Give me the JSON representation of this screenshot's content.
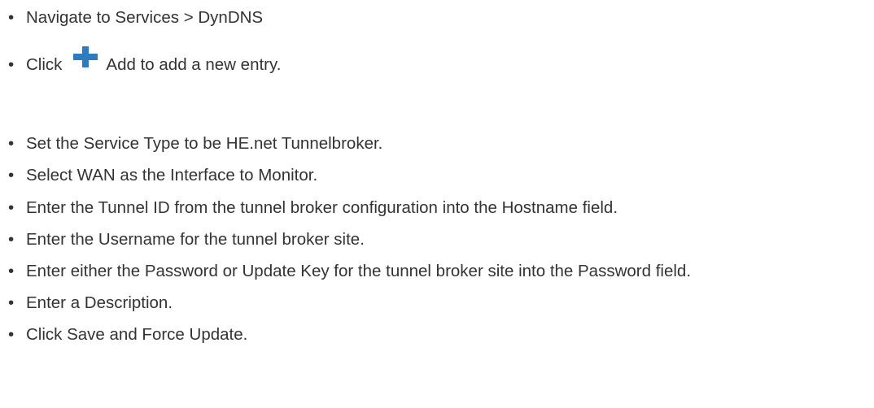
{
  "bullet": "•",
  "steps": [
    "Navigate to Services > DynDNS",
    "Click",
    "Add to add a new entry.",
    "Set the Service Type to be HE.net Tunnelbroker.",
    "Select WAN as the Interface to Monitor.",
    "Enter the Tunnel ID from the tunnel broker configuration into the Hostname field.",
    "Enter the Username for the tunnel broker site.",
    "Enter either the Password or Update Key for the tunnel broker site into the Password field.",
    "Enter a Description.",
    "Click Save and Force Update."
  ],
  "icons": {
    "add": "plus-icon"
  },
  "colors": {
    "text": "#333333",
    "icon": "#2e7bbf"
  }
}
